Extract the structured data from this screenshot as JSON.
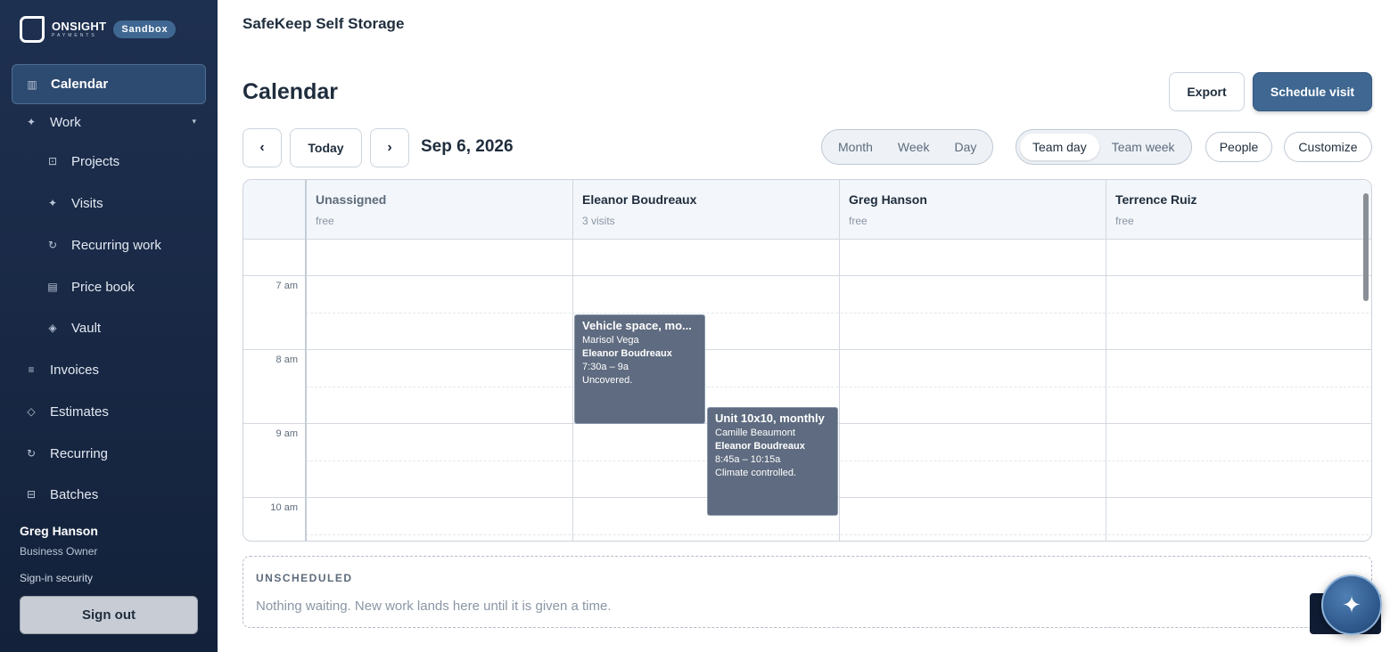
{
  "brand": {
    "name": "ONSIGHT",
    "sub": "PAYMENTS",
    "badge": "Sandbox"
  },
  "sidebar": {
    "items": [
      {
        "label": "Calendar",
        "icon": "calendar-icon"
      },
      {
        "label": "Work",
        "icon": "sparkle-icon"
      },
      {
        "label": "Projects",
        "icon": "projects-icon"
      },
      {
        "label": "Visits",
        "icon": "sparkle-icon"
      },
      {
        "label": "Recurring work",
        "icon": "refresh-icon"
      },
      {
        "label": "Price book",
        "icon": "book-icon"
      },
      {
        "label": "Vault",
        "icon": "diamond-icon"
      },
      {
        "label": "Invoices",
        "icon": "list-icon"
      },
      {
        "label": "Estimates",
        "icon": "diamond-outline-icon"
      },
      {
        "label": "Recurring",
        "icon": "refresh-icon"
      },
      {
        "label": "Batches",
        "icon": "batches-icon"
      }
    ],
    "user": {
      "name": "Greg Hanson",
      "role": "Business Owner"
    },
    "security_link": "Sign-in security",
    "sign_out": "Sign out"
  },
  "header": {
    "org": "SafeKeep Self Storage",
    "title": "Calendar",
    "export": "Export",
    "schedule": "Schedule visit"
  },
  "toolbar": {
    "prev": "‹",
    "today": "Today",
    "next": "›",
    "date": "Sep 6, 2026",
    "views": [
      "Month",
      "Week",
      "Day"
    ],
    "team_views": [
      "Team day",
      "Team week"
    ],
    "team_active": "Team day",
    "people": "People",
    "customize": "Customize"
  },
  "calendar": {
    "columns": [
      {
        "name": "Unassigned",
        "sub": "free"
      },
      {
        "name": "Eleanor Boudreaux",
        "sub": "3 visits"
      },
      {
        "name": "Greg Hanson",
        "sub": "free"
      },
      {
        "name": "Terrence Ruiz",
        "sub": "free"
      }
    ],
    "times": [
      "7 am",
      "8 am",
      "9 am",
      "10 am"
    ],
    "events": [
      {
        "title": "Vehicle space, mo...",
        "customer": "Marisol Vega",
        "assignee": "Eleanor Boudreaux",
        "time": "7:30a – 9a",
        "note": "Uncovered."
      },
      {
        "title": "Unit 10x10, monthly",
        "customer": "Camille Beaumont",
        "assignee": "Eleanor Boudreaux",
        "time": "8:45a – 10:15a",
        "note": "Climate controlled."
      }
    ]
  },
  "unscheduled": {
    "title": "UNSCHEDULED",
    "message": "Nothing waiting. New work lands here until it is given a time."
  },
  "fab": {
    "icon": "sparkle-icon",
    "glyph": "✦"
  }
}
